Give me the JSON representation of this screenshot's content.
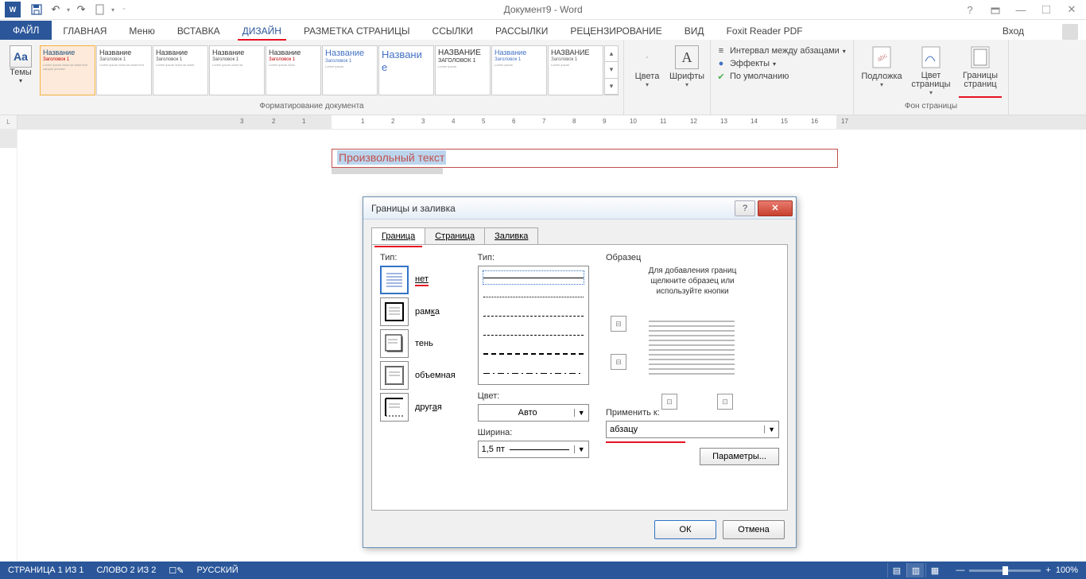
{
  "titlebar": {
    "title": "Документ9 - Word"
  },
  "tabs": {
    "file": "ФАЙЛ",
    "items": [
      "ГЛАВНАЯ",
      "Меню",
      "ВСТАВКА",
      "ДИЗАЙН",
      "РАЗМЕТКА СТРАНИЦЫ",
      "ССЫЛКИ",
      "РАССЫЛКИ",
      "РЕЦЕНЗИРОВАНИЕ",
      "ВИД",
      "Foxit Reader PDF"
    ],
    "active_index": 3,
    "login": "Вход"
  },
  "ribbon": {
    "themes_label": "Темы",
    "gallery_items": [
      "Название",
      "Название",
      "Название",
      "Название",
      "Название",
      "Название",
      "Названи",
      "НАЗВАНИЕ",
      "Название",
      "НАЗВАНИЕ"
    ],
    "formatting_group": "Форматирование документа",
    "colors_label": "Цвета",
    "fonts_label": "Шрифты",
    "spacing_label": "Интервал между абзацами",
    "effects_label": "Эффекты",
    "default_label": "По умолчанию",
    "watermark_label": "Подложка",
    "pagecolor_label": "Цвет\nстраницы",
    "pageborders_label": "Границы\nстраниц",
    "bg_group": "Фон страницы"
  },
  "ruler": {
    "marks": [
      "3",
      "2",
      "1",
      "",
      "1",
      "2",
      "3",
      "4",
      "5",
      "6",
      "7",
      "8",
      "9",
      "10",
      "11",
      "12",
      "13",
      "14",
      "15",
      "16",
      "17"
    ]
  },
  "document": {
    "text": "Произвольный текст"
  },
  "dialog": {
    "title": "Границы и заливка",
    "tabs": [
      "Граница",
      "Страница",
      "Заливка"
    ],
    "active_tab": 0,
    "type_label": "Тип:",
    "types": [
      {
        "label": "нет"
      },
      {
        "label": "рамка"
      },
      {
        "label": "тень"
      },
      {
        "label": "объемная"
      },
      {
        "label": "другая"
      }
    ],
    "style_label": "Тип:",
    "color_label": "Цвет:",
    "color_value": "Авто",
    "width_label": "Ширина:",
    "width_value": "1,5 пт",
    "preview_label": "Образец",
    "preview_text": "Для добавления границ\nщелкните образец или\nиспользуйте кнопки",
    "apply_label": "Применить к:",
    "apply_value": "абзацу",
    "params_btn": "Параметры...",
    "ok": "ОК",
    "cancel": "Отмена"
  },
  "statusbar": {
    "page": "СТРАНИЦА 1 ИЗ 1",
    "words": "СЛОВО 2 ИЗ 2",
    "lang": "РУССКИЙ",
    "zoom": "100%"
  }
}
